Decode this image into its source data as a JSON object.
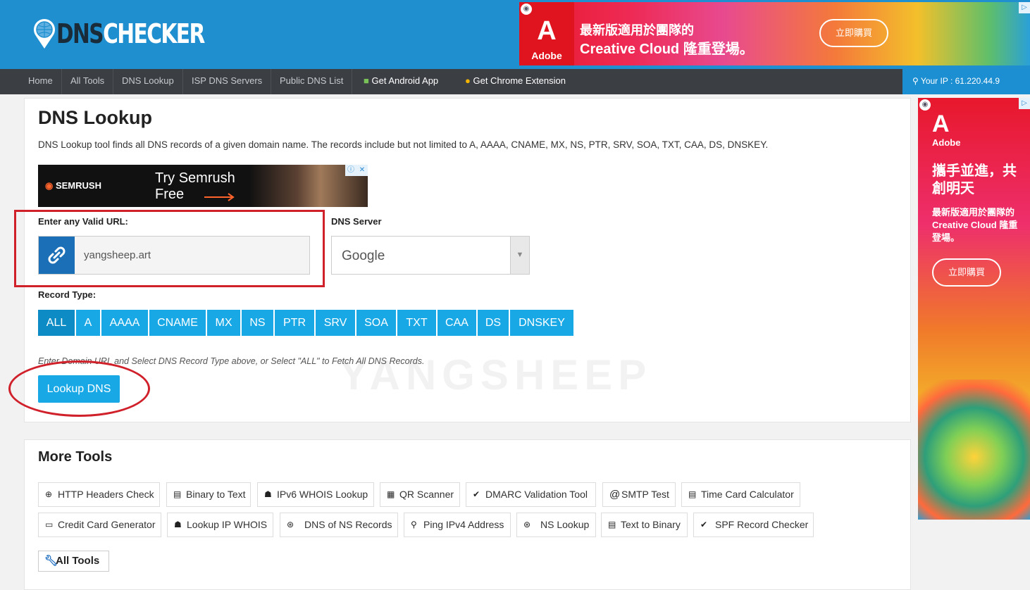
{
  "logo": {
    "text_dark": "DNS",
    "text_light": "CHECKER"
  },
  "top_ad": {
    "brand": "Adobe",
    "line1": "最新版適用於團隊的",
    "line2": "Creative Cloud 隆重登場。",
    "button": "立即購買"
  },
  "nav": {
    "items": [
      "Home",
      "All Tools",
      "DNS Lookup",
      "ISP DNS Servers",
      "Public DNS List"
    ],
    "android": "Get Android App",
    "chrome": "Get Chrome Extension",
    "ip": "Your IP : 61.220.44.9"
  },
  "main": {
    "title": "DNS Lookup",
    "description": "DNS Lookup tool finds all DNS records of a given domain name. The records include but not limited to A, AAAA, CNAME, MX, NS, PTR, SRV, SOA, TXT, CAA, DS, DNSKEY.",
    "semrush_ad": {
      "brand": "SEMRUSH",
      "cta_line1": "Try Semrush",
      "cta_line2": "Free"
    },
    "url_label": "Enter any Valid URL:",
    "url_value": "yangsheep.art",
    "dns_server_label": "DNS Server",
    "dns_server_value": "Google",
    "record_type_label": "Record Type:",
    "record_types": [
      "ALL",
      "A",
      "AAAA",
      "CNAME",
      "MX",
      "NS",
      "PTR",
      "SRV",
      "SOA",
      "TXT",
      "CAA",
      "DS",
      "DNSKEY"
    ],
    "active_record_type": "ALL",
    "hint": "Enter Domain URL and Select DNS Record Type above, or Select \"ALL\" to Fetch All DNS Records.",
    "lookup_button": "Lookup DNS",
    "watermark": "YANGSHEEP"
  },
  "more_tools": {
    "title": "More Tools",
    "row1": [
      "HTTP Headers Check",
      "Binary to Text",
      "IPv6 WHOIS Lookup",
      "QR Scanner",
      "DMARC Validation Tool",
      "SMTP Test",
      "Time Card Calculator"
    ],
    "row2": [
      "Credit Card Generator",
      "Lookup IP WHOIS",
      "DNS of NS Records",
      "Ping IPv4 Address",
      "NS Lookup",
      "Text to Binary",
      "SPF Record Checker"
    ],
    "all_tools": "All Tools"
  },
  "side_ad": {
    "brand": "Adobe",
    "headline": "攜手並進，共創明天",
    "sub": "最新版適用於團隊的 Creative Cloud 隆重登場。",
    "button": "立即購買"
  },
  "colors": {
    "header_blue": "#1f8fd0",
    "nav_dark": "#3b3f44",
    "button_blue": "#18a8e6",
    "annotation_red": "#d0202a"
  }
}
